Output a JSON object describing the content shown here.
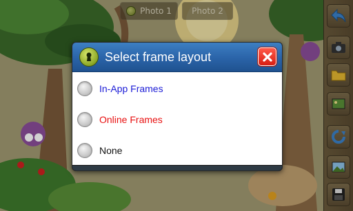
{
  "tabs": {
    "photo1": "Photo 1",
    "photo2": "Photo 2"
  },
  "toolbar": {
    "items": [
      "back-arrow-icon",
      "camera-icon",
      "folder-icon",
      "gallery-icon",
      "refresh-icon",
      "landscape-icon",
      "save-icon"
    ]
  },
  "dialog": {
    "title": "Select frame layout",
    "icon": "keyhole-icon",
    "options": [
      {
        "label": "In-App Frames",
        "color": "#1a1ad6"
      },
      {
        "label": "Online Frames",
        "color": "#e81010"
      },
      {
        "label": "None",
        "color": "#111111"
      }
    ]
  },
  "colors": {
    "header": "#2a63a8",
    "close": "#d81e12",
    "accent": "#8aa624"
  }
}
